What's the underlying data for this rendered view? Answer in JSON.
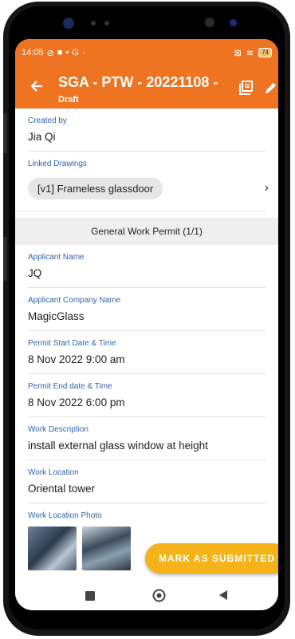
{
  "status_bar": {
    "time": "14:05",
    "icons_left": [
      "notif-off-icon",
      "teams-icon",
      "trash-icon",
      "google-icon"
    ],
    "icons_right": [
      "close-box-icon",
      "wifi-icon"
    ],
    "battery": "74"
  },
  "header": {
    "title": "SGA - PTW - 20221108 - ",
    "subtitle": "Draft",
    "colors": {
      "appbar": "#ee7421",
      "label": "#2f65a8",
      "fab": "#f6b319"
    }
  },
  "fields": {
    "created_by": {
      "label": "Created by",
      "value": "Jia Qi"
    },
    "linked_drawings": {
      "label": "Linked Drawings",
      "chip": "[v1] Frameless glassdoor"
    }
  },
  "section_title": "General Work Permit (1/1)",
  "permit": {
    "applicant_name": {
      "label": "Applicant Name",
      "value": "JQ"
    },
    "company": {
      "label": "Applicant Company Name",
      "value": "MagicGlass"
    },
    "start": {
      "label": "Permit Start Date & Time",
      "value": "8 Nov 2022 9:00 am"
    },
    "end": {
      "label": "Permit End date & Time",
      "value": "8 Nov 2022 6:00 pm"
    },
    "description": {
      "label": "Work Description",
      "value": "install external glass window at height"
    },
    "location": {
      "label": "Work Location",
      "value": "Oriental tower"
    },
    "photo": {
      "label": "Work Location Photo"
    }
  },
  "fab_label": "MARK AS SUBMITTED"
}
